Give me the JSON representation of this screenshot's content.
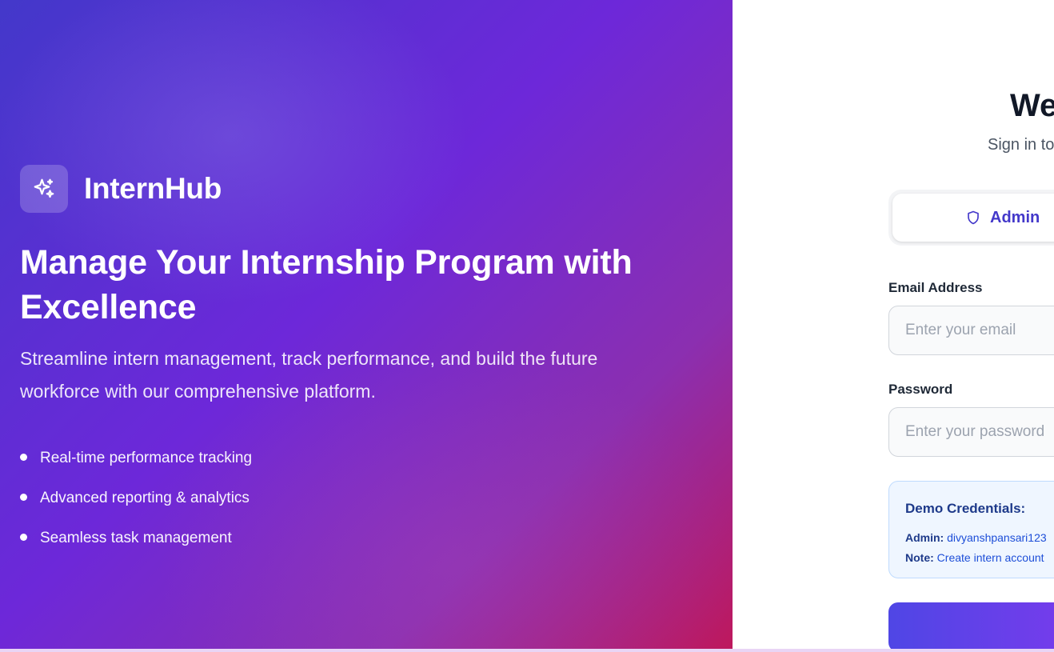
{
  "brand": {
    "name": "InternHub",
    "logo_icon": "sparkles-icon"
  },
  "hero": {
    "title": "Manage Your Internship Program with Excellence",
    "subtitle": "Streamline intern management, track performance, and build the future workforce with our comprehensive platform.",
    "features": [
      "Real-time performance tracking",
      "Advanced reporting & analytics",
      "Seamless task management"
    ]
  },
  "login": {
    "heading": "We",
    "subheading": "Sign in to",
    "role_tab": {
      "label": "Admin",
      "icon": "shield-icon"
    },
    "email": {
      "label": "Email Address",
      "placeholder": "Enter your email",
      "value": ""
    },
    "password": {
      "label": "Password",
      "placeholder": "Enter your password",
      "value": ""
    },
    "demo": {
      "title": "Demo Credentials:",
      "admin_label": "Admin:",
      "admin_value": "divyanshpansari123",
      "note_label": "Note:",
      "note_value": "Create intern account"
    },
    "submit_label": ""
  },
  "colors": {
    "brand_accent": "#4338ca",
    "gradient_start": "#4338ca",
    "gradient_mid": "#6d28d9",
    "gradient_end": "#be185d",
    "demo_bg": "#eff6ff",
    "demo_text": "#1d4ed8"
  }
}
